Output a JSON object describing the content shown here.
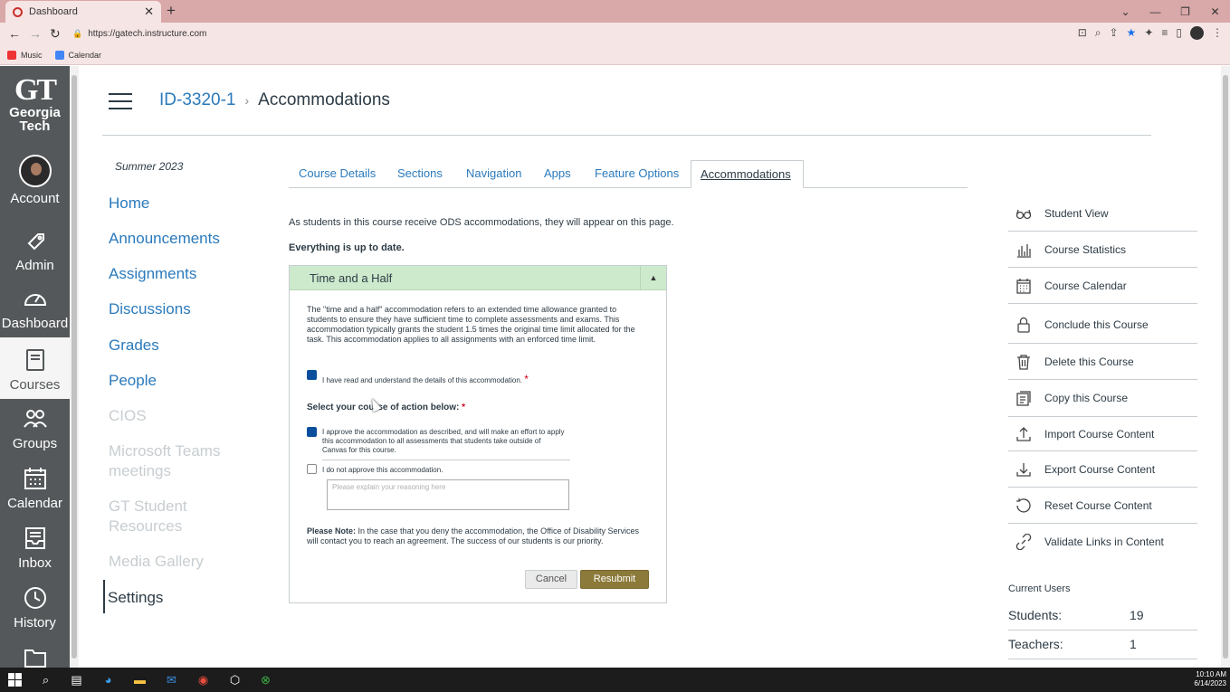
{
  "browser": {
    "tab_title": "Dashboard",
    "url": "https://gatech.instructure.com",
    "bookmarks": [
      "Music",
      "Calendar"
    ]
  },
  "global_nav": {
    "logo_letters": "GT",
    "logo_line1": "Georgia",
    "logo_line2": "Tech",
    "items": [
      {
        "label": "Account",
        "icon": "avatar"
      },
      {
        "label": "Admin",
        "icon": "shield-icon"
      },
      {
        "label": "Dashboard",
        "icon": "speedometer-icon"
      },
      {
        "label": "Courses",
        "icon": "book-icon"
      },
      {
        "label": "Groups",
        "icon": "people-icon"
      },
      {
        "label": "Calendar",
        "icon": "calendar-icon"
      },
      {
        "label": "Inbox",
        "icon": "inbox-icon"
      },
      {
        "label": "History",
        "icon": "clock-icon"
      }
    ]
  },
  "header": {
    "course_code": "ID-3320-1",
    "separator": "›",
    "page_title": "Accommodations"
  },
  "course_nav": {
    "term": "Summer 2023",
    "items": [
      {
        "label": "Home"
      },
      {
        "label": "Announcements"
      },
      {
        "label": "Assignments"
      },
      {
        "label": "Discussions"
      },
      {
        "label": "Grades"
      },
      {
        "label": "People"
      },
      {
        "label": "CIOS"
      },
      {
        "label": "Microsoft Teams meetings"
      },
      {
        "label": "GT Student Resources"
      },
      {
        "label": "Media Gallery"
      },
      {
        "label": "Settings"
      }
    ]
  },
  "tabs": [
    {
      "label": "Course Details"
    },
    {
      "label": "Sections"
    },
    {
      "label": "Navigation"
    },
    {
      "label": "Apps"
    },
    {
      "label": "Feature Options"
    },
    {
      "label": "Accommodations"
    }
  ],
  "main": {
    "intro": "As students in this course receive ODS accommodations, they will appear on this page.",
    "status": "Everything is up to date.",
    "panel": {
      "title": "Time and a Half",
      "toggle": "▲",
      "description": "The \"time and a half\" accommodation refers to an extended time allowance granted to students to ensure they have sufficient time to complete assessments and exams. This accommodation typically grants the student 1.5 times the original time limit allocated for the task. This accommodation applies to all assignments with an enforced time limit.",
      "ack_label": "I have read and understand the details of this accommodation.",
      "required": "*",
      "select_label": "Select your course of action below:",
      "approve_label": "I approve the accommodation as described, and will make an effort to apply this accommodation to all assessments that students take outside of Canvas for this course.",
      "deny_label": "I do not approve this accommodation.",
      "reason_placeholder": "Please explain your reasoning here",
      "note_bold": "Please Note:",
      "note_text": " In the case that you deny the accommodation, the Office of Disability Services will contact you to reach an agreement. The success of our students is our priority.",
      "cancel": "Cancel",
      "resubmit": "Resubmit"
    }
  },
  "sidebar": {
    "actions": [
      {
        "label": "Student View",
        "icon": "glasses-icon"
      },
      {
        "label": "Course Statistics",
        "icon": "bar-chart-icon"
      },
      {
        "label": "Course Calendar",
        "icon": "calendar-icon"
      },
      {
        "label": "Conclude this Course",
        "icon": "lock-icon"
      },
      {
        "label": "Delete this Course",
        "icon": "trash-icon"
      },
      {
        "label": "Copy this Course",
        "icon": "copy-icon"
      },
      {
        "label": "Import Course Content",
        "icon": "upload-icon"
      },
      {
        "label": "Export Course Content",
        "icon": "download-icon"
      },
      {
        "label": "Reset Course Content",
        "icon": "reset-icon"
      },
      {
        "label": "Validate Links in Content",
        "icon": "link-icon"
      }
    ],
    "current_users_title": "Current Users",
    "users": [
      {
        "label": "Students:",
        "value": "19"
      },
      {
        "label": "Teachers:",
        "value": "1"
      }
    ]
  },
  "taskbar": {
    "time": "10:10 AM",
    "date": "6/14/2023"
  },
  "colors": {
    "global_nav": "#54585a",
    "link": "#2b7abc",
    "panel_header": "#cdeacd",
    "resubmit": "#8c7a3a",
    "checkbox": "#0b4e9c"
  }
}
